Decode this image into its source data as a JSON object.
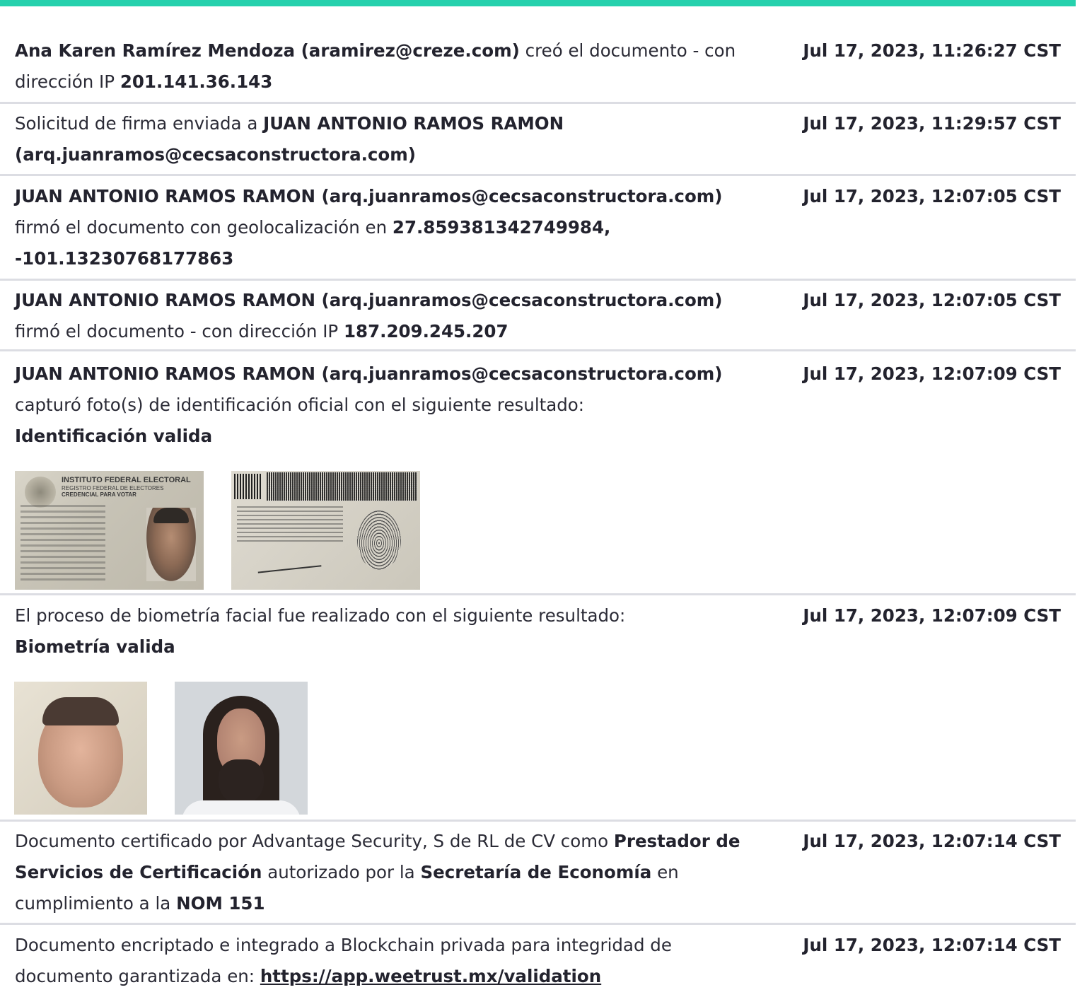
{
  "colors": {
    "accent": "#26d1ad",
    "divider": "#dcdde3",
    "text": "#23232e"
  },
  "events": [
    {
      "a1": "Ana Karen Ramírez Mendoza (aramirez@creze.com)",
      "a2": " creó el documento - con dirección IP ",
      "a3": "201.141.36.143",
      "ts": "Jul 17, 2023, 11:26:27 CST"
    },
    {
      "a1": "Solicitud de firma enviada a ",
      "a2": "JUAN ANTONIO RAMOS RAMON (arq.juanramos@cecsaconstructora.com)",
      "ts": "Jul 17, 2023, 11:29:57 CST"
    },
    {
      "a1": "JUAN ANTONIO RAMOS RAMON (arq.juanramos@cecsaconstructora.com)",
      "a2": " firmó el documento con geolocalización en ",
      "a3": "27.859381342749984, -101.13230768177863",
      "ts": "Jul 17, 2023, 12:07:05 CST"
    },
    {
      "a1": "JUAN ANTONIO RAMOS RAMON (arq.juanramos@cecsaconstructora.com)",
      "a2": " firmó el documento - con dirección IP ",
      "a3": "187.209.245.207",
      "ts": "Jul 17, 2023, 12:07:05 CST"
    },
    {
      "a1": "JUAN ANTONIO RAMOS RAMON (arq.juanramos@cecsaconstructora.com)",
      "a2": " capturó foto(s) de identificación oficial con el siguiente resultado:",
      "a3": "Identificación valida",
      "ts": "Jul 17, 2023, 12:07:09 CST",
      "card": {
        "line1": "INSTITUTO FEDERAL ELECTORAL",
        "line2": "REGISTRO FEDERAL DE ELECTORES",
        "line3": "CREDENCIAL PARA VOTAR"
      }
    },
    {
      "a1": "El proceso de biometría facial fue realizado con el siguiente resultado:",
      "a2": "Biometría valida",
      "ts": "Jul 17, 2023, 12:07:09 CST"
    },
    {
      "a1": "Documento certificado por Advantage Security, S de RL de CV como ",
      "a2": "Prestador de Servicios de Certificación",
      "a3": " autorizado por la ",
      "a4": "Secretaría de Economía",
      "a5": " en cumplimiento a la ",
      "a6": "NOM 151",
      "ts": "Jul 17, 2023, 12:07:14 CST"
    },
    {
      "a1": "Documento encriptado e integrado a Blockchain privada para integridad de documento garantizada en: ",
      "a2": "https://app.weetrust.mx/validation",
      "ts": "Jul 17, 2023, 12:07:14 CST"
    }
  ]
}
